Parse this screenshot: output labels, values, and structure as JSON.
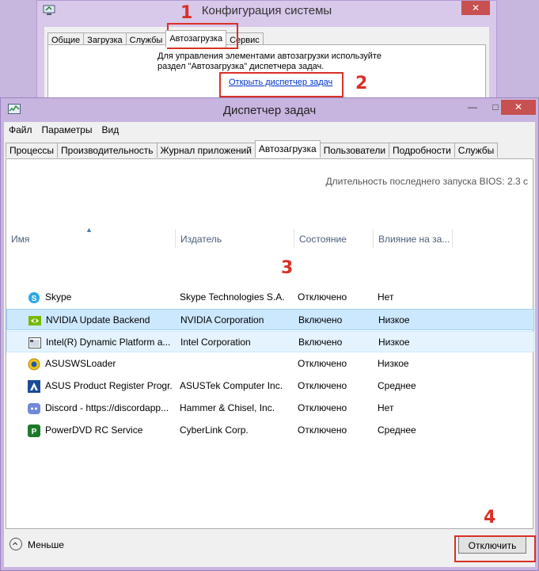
{
  "msconfig": {
    "title": "Конфигурация системы",
    "close": "✕",
    "tabs": [
      "Общие",
      "Загрузка",
      "Службы",
      "Автозагрузка",
      "Сервис"
    ],
    "active_tab": 3,
    "description": "Для управления элементами автозагрузки используйте раздел \"Автозагрузка\" диспетчера задач.",
    "link": "Открыть диспетчер задач"
  },
  "taskmgr": {
    "title": "Диспетчер задач",
    "window_buttons": {
      "minimize": "—",
      "maximize": "□",
      "close": "✕"
    },
    "menu": [
      "Файл",
      "Параметры",
      "Вид"
    ],
    "tabs": [
      "Процессы",
      "Производительность",
      "Журнал приложений",
      "Автозагрузка",
      "Пользователи",
      "Подробности",
      "Службы"
    ],
    "active_tab": 3,
    "bios": "Длительность последнего запуска BIOS: 2.3 с",
    "columns": [
      "Имя",
      "Издатель",
      "Состояние",
      "Влияние на за..."
    ],
    "rows": [
      {
        "name": "Skype",
        "publisher": "Skype Technologies S.A.",
        "status": "Отключено",
        "impact": "Нет",
        "icon": "skype-icon"
      },
      {
        "name": "NVIDIA Update Backend",
        "publisher": "NVIDIA Corporation",
        "status": "Включено",
        "impact": "Низкое",
        "icon": "nvidia-icon"
      },
      {
        "name": "Intel(R) Dynamic Platform a...",
        "publisher": "Intel Corporation",
        "status": "Включено",
        "impact": "Низкое",
        "icon": "intel-app-icon"
      },
      {
        "name": "ASUSWSLoader",
        "publisher": "",
        "status": "Отключено",
        "impact": "Низкое",
        "icon": "asus-loader-icon"
      },
      {
        "name": "ASUS Product Register Progr...",
        "publisher": "ASUSTek Computer Inc.",
        "status": "Отключено",
        "impact": "Среднее",
        "icon": "asus-icon"
      },
      {
        "name": "Discord - https://discordapp...",
        "publisher": "Hammer & Chisel, Inc.",
        "status": "Отключено",
        "impact": "Нет",
        "icon": "discord-icon"
      },
      {
        "name": "PowerDVD RC Service",
        "publisher": "CyberLink Corp.",
        "status": "Отключено",
        "impact": "Среднее",
        "icon": "powerdvd-icon"
      }
    ],
    "selected_row": 1,
    "hover_row": 2,
    "fewer_label": "Меньше",
    "disable_button": "Отключить"
  },
  "annotations": [
    "1",
    "2",
    "3",
    "4"
  ],
  "colors": {
    "callout": "#d93025",
    "selection": "#cce8ff",
    "desktop": "#c7b6dd"
  }
}
